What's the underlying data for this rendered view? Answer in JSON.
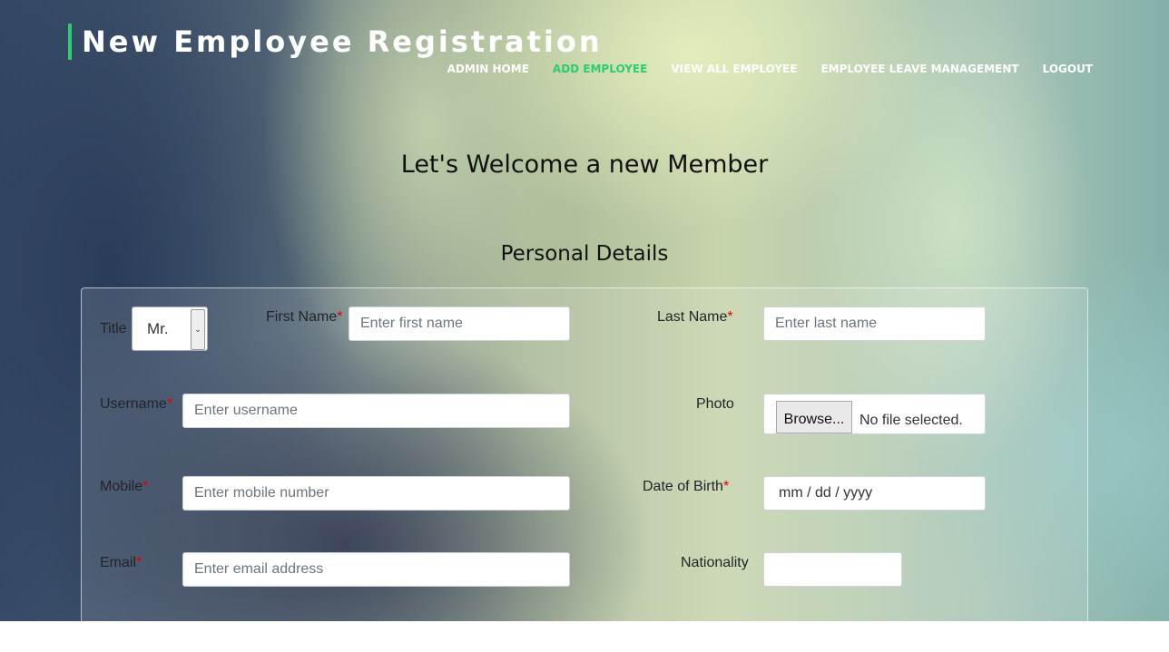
{
  "header": {
    "brand_title": "New Employee Registration",
    "accent_color": "#2ecc71"
  },
  "nav": {
    "items": [
      {
        "label": "ADMIN HOME",
        "active": false
      },
      {
        "label": "ADD EMPLOYEE",
        "active": true
      },
      {
        "label": "VIEW ALL EMPLOYEE",
        "active": false
      },
      {
        "label": "EMPLOYEE LEAVE MANAGEMENT",
        "active": false
      },
      {
        "label": "LOGOUT",
        "active": false
      }
    ]
  },
  "main": {
    "welcome_heading": "Let's Welcome a new Member",
    "section_heading": "Personal Details"
  },
  "form": {
    "title": {
      "label": "Title",
      "selected": "Mr."
    },
    "first_name": {
      "label": "First Name",
      "required_mark": "*",
      "placeholder": "Enter first name"
    },
    "last_name": {
      "label": "Last Name",
      "required_mark": "*",
      "placeholder": "Enter last name"
    },
    "username": {
      "label": "Username",
      "required_mark": "*",
      "placeholder": "Enter username"
    },
    "photo": {
      "label": "Photo",
      "button_label": "Browse...",
      "status": "No file selected."
    },
    "mobile": {
      "label": "Mobile",
      "required_mark": "*",
      "placeholder": "Enter mobile number"
    },
    "dob": {
      "label": "Date of Birth",
      "required_mark": "*",
      "placeholder": "mm / dd / yyyy"
    },
    "email": {
      "label": "Email",
      "required_mark": "*",
      "placeholder": "Enter email address"
    },
    "nationality": {
      "label": "Nationality",
      "value": ""
    }
  },
  "icons": {
    "select_arrow": "chevron-down-icon"
  }
}
